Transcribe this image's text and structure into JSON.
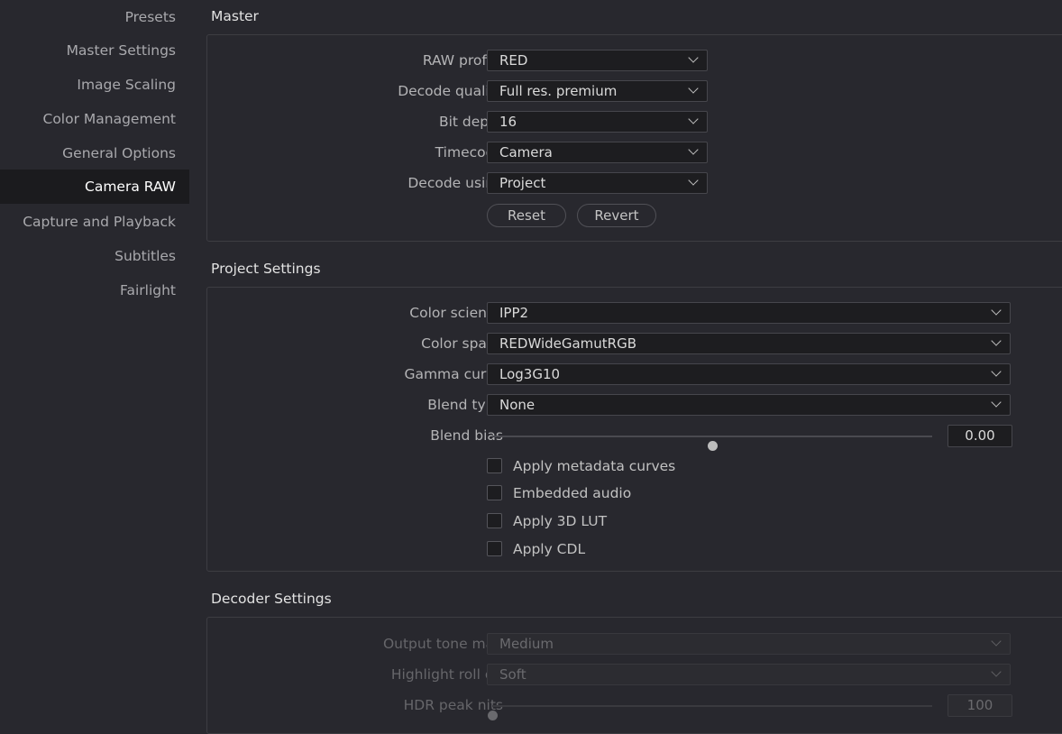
{
  "sidebar": {
    "items": [
      {
        "label": "Presets"
      },
      {
        "label": "Master Settings"
      },
      {
        "label": "Image Scaling"
      },
      {
        "label": "Color Management"
      },
      {
        "label": "General Options"
      },
      {
        "label": "Camera RAW",
        "active": true
      },
      {
        "label": "Capture and Playback"
      },
      {
        "label": "Subtitles"
      },
      {
        "label": "Fairlight"
      }
    ]
  },
  "master": {
    "title": "Master",
    "raw_profile": {
      "label": "RAW profile",
      "value": "RED"
    },
    "decode_quality": {
      "label": "Decode quality",
      "value": "Full res. premium"
    },
    "bit_depth": {
      "label": "Bit depth",
      "value": "16"
    },
    "timecode": {
      "label": "Timecode",
      "value": "Camera"
    },
    "decode_using": {
      "label": "Decode using",
      "value": "Project"
    },
    "reset_label": "Reset",
    "revert_label": "Revert"
  },
  "project": {
    "title": "Project Settings",
    "color_science": {
      "label": "Color science",
      "value": "IPP2"
    },
    "color_space": {
      "label": "Color space",
      "value": "REDWideGamutRGB"
    },
    "gamma_curve": {
      "label": "Gamma curve",
      "value": "Log3G10"
    },
    "blend_type": {
      "label": "Blend type",
      "value": "None"
    },
    "blend_bias": {
      "label": "Blend bias",
      "value": "0.00",
      "slider_fraction": 0.5
    },
    "checkboxes": [
      {
        "label": "Apply metadata curves",
        "checked": false
      },
      {
        "label": "Embedded audio",
        "checked": false
      },
      {
        "label": "Apply 3D LUT",
        "checked": false
      },
      {
        "label": "Apply CDL",
        "checked": false
      }
    ]
  },
  "decoder": {
    "title": "Decoder Settings",
    "output_tone_map": {
      "label": "Output tone map",
      "value": "Medium"
    },
    "highlight_roll_off": {
      "label": "Highlight roll off",
      "value": "Soft"
    },
    "hdr_peak_nits": {
      "label": "HDR peak nits",
      "value": "100",
      "slider_fraction": 0.0
    }
  },
  "colors": {
    "background": "#28282e",
    "sidebar_active": "#1b1b1e",
    "input_bg": "#1d1d20"
  }
}
